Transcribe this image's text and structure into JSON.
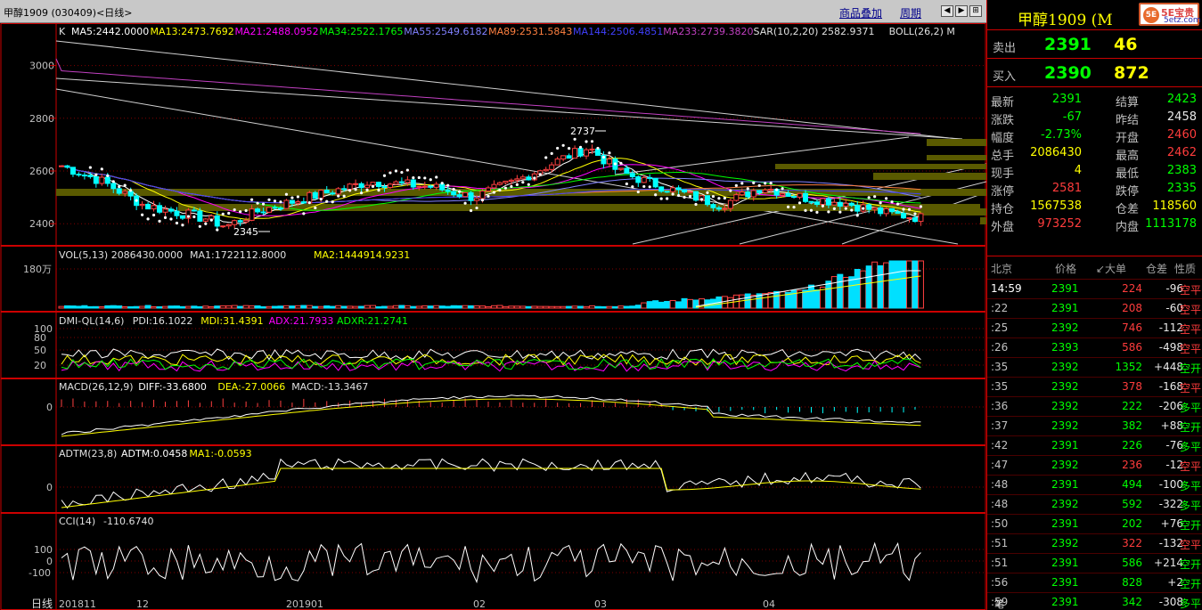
{
  "titlebar": {
    "title": "甲醇1909 (030409)<日线>",
    "link_overlay": "商品叠加",
    "link_period": "周期"
  },
  "main_legend": {
    "prefix": "K",
    "items": [
      {
        "text": "MA5:2442.0000",
        "color": "#ffffff"
      },
      {
        "text": "MA13:2473.7692",
        "color": "#ffff00"
      },
      {
        "text": "MA21:2488.0952",
        "color": "#ff00ff"
      },
      {
        "text": "MA34:2522.1765",
        "color": "#00ff00"
      },
      {
        "text": "MA55:2549.6182",
        "color": "#8080ff"
      },
      {
        "text": "MA89:2531.5843",
        "color": "#ff8040"
      },
      {
        "text": "MA144:2506.4851",
        "color": "#4040ff"
      },
      {
        "text": "MA233:2739.3820",
        "color": "#c040c0"
      },
      {
        "text": "SAR(10,2,20)  2582.9371",
        "color": "#e0e0e0"
      },
      {
        "text": "BOLL(26,2) M",
        "color": "#e0e0e0"
      }
    ]
  },
  "price_axis": [
    "3000",
    "2800",
    "2600",
    "2400"
  ],
  "annotations": {
    "high": "2737",
    "low": "2345"
  },
  "vol": {
    "legend": [
      "VOL(5,13) 2086430.0000",
      "MA1:1722112.8000",
      "MA2:1444914.9231"
    ],
    "axis": "180万"
  },
  "dmi": {
    "legend": [
      "DMI-QL(14,6)",
      "PDI:16.1022",
      "MDI:31.4391",
      "ADX:21.7933",
      "ADXR:21.2741"
    ],
    "axis": [
      "100",
      "80",
      "50",
      "20"
    ]
  },
  "macd": {
    "legend": [
      "MACD(26,12,9)",
      "DIFF:-33.6800",
      "DEA:-27.0066",
      "MACD:-13.3467"
    ],
    "axis": "0"
  },
  "adtm": {
    "legend": [
      "ADTM(23,8)",
      "ADTM:0.0458",
      "MA1:-0.0593"
    ],
    "axis": "0"
  },
  "cci": {
    "legend": [
      "CCI(14)",
      "-110.6740"
    ],
    "axis": [
      "100",
      "0",
      "-100"
    ]
  },
  "date_axis": {
    "label": "日线",
    "ticks": [
      "201811",
      "12",
      "201901",
      "02",
      "03",
      "04"
    ]
  },
  "right": {
    "name": "甲醇1909 (M",
    "logo_badge": "5E",
    "logo_text": "5E宝贵",
    "logo_sub": "5etz.com",
    "sell": {
      "label": "卖出",
      "price": "2391",
      "vol": "46"
    },
    "buy": {
      "label": "买入",
      "price": "2390",
      "vol": "872"
    },
    "stats": [
      {
        "k1": "最新",
        "v1": "2391",
        "c1": "g",
        "k2": "结算",
        "v2": "2423",
        "c2": "g"
      },
      {
        "k1": "涨跌",
        "v1": "-67",
        "c1": "g",
        "k2": "昨结",
        "v2": "2458",
        "c2": "w"
      },
      {
        "k1": "幅度",
        "v1": "-2.73%",
        "c1": "g",
        "k2": "开盘",
        "v2": "2460",
        "c2": "r"
      },
      {
        "k1": "总手",
        "v1": "2086430",
        "c1": "y",
        "k2": "最高",
        "v2": "2462",
        "c2": "r"
      },
      {
        "k1": "现手",
        "v1": "4",
        "c1": "y",
        "k2": "最低",
        "v2": "2383",
        "c2": "g"
      },
      {
        "k1": "涨停",
        "v1": "2581",
        "c1": "r",
        "k2": "跌停",
        "v2": "2335",
        "c2": "g"
      },
      {
        "k1": "持仓",
        "v1": "1567538",
        "c1": "y",
        "k2": "仓差",
        "v2": "118560",
        "c2": "y"
      },
      {
        "k1": "外盘",
        "v1": "973252",
        "c1": "r",
        "k2": "内盘",
        "v2": "1113178",
        "c2": "g"
      }
    ],
    "ticks_header": [
      "北京",
      "价格",
      "↙大单",
      "仓差",
      "性质"
    ],
    "ticks": [
      {
        "t": "14:59",
        "p": "2391",
        "s": "224",
        "o": "-96",
        "n": "空平",
        "sc": "r",
        "nc": "r"
      },
      {
        "t": ":22",
        "p": "2391",
        "s": "208",
        "o": "-60",
        "n": "空平",
        "sc": "r",
        "nc": "r"
      },
      {
        "t": ":25",
        "p": "2392",
        "s": "746",
        "o": "-112",
        "n": "空平",
        "sc": "r",
        "nc": "r"
      },
      {
        "t": ":26",
        "p": "2393",
        "s": "586",
        "o": "-498",
        "n": "空平",
        "sc": "r",
        "nc": "r"
      },
      {
        "t": ":35",
        "p": "2392",
        "s": "1352",
        "o": "+448",
        "n": "空开",
        "sc": "g",
        "nc": "g"
      },
      {
        "t": ":35",
        "p": "2392",
        "s": "378",
        "o": "-168",
        "n": "空平",
        "sc": "r",
        "nc": "r"
      },
      {
        "t": ":36",
        "p": "2392",
        "s": "222",
        "o": "-206",
        "n": "多平",
        "sc": "g",
        "nc": "g"
      },
      {
        "t": ":37",
        "p": "2392",
        "s": "382",
        "o": "+88",
        "n": "空开",
        "sc": "g",
        "nc": "g"
      },
      {
        "t": ":42",
        "p": "2391",
        "s": "226",
        "o": "-76",
        "n": "多平",
        "sc": "g",
        "nc": "g"
      },
      {
        "t": ":47",
        "p": "2392",
        "s": "236",
        "o": "-12",
        "n": "空平",
        "sc": "r",
        "nc": "r"
      },
      {
        "t": ":48",
        "p": "2391",
        "s": "494",
        "o": "-100",
        "n": "多平",
        "sc": "g",
        "nc": "g"
      },
      {
        "t": ":48",
        "p": "2392",
        "s": "592",
        "o": "-322",
        "n": "多平",
        "sc": "g",
        "nc": "g"
      },
      {
        "t": ":50",
        "p": "2391",
        "s": "202",
        "o": "+76",
        "n": "空开",
        "sc": "g",
        "nc": "g"
      },
      {
        "t": ":51",
        "p": "2392",
        "s": "322",
        "o": "-132",
        "n": "空平",
        "sc": "r",
        "nc": "r"
      },
      {
        "t": ":51",
        "p": "2391",
        "s": "586",
        "o": "+214",
        "n": "空开",
        "sc": "g",
        "nc": "g"
      },
      {
        "t": ":56",
        "p": "2391",
        "s": "828",
        "o": "+2",
        "n": "空开",
        "sc": "g",
        "nc": "g"
      },
      {
        "t": ":59",
        "p": "2391",
        "s": "342",
        "o": "-308",
        "n": "多平",
        "sc": "g",
        "nc": "g"
      }
    ],
    "footer_tab": "笔"
  }
}
